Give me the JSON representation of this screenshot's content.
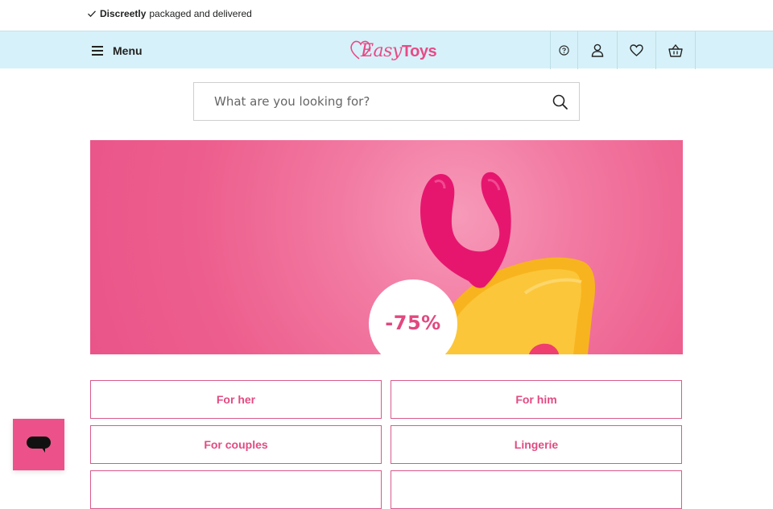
{
  "topbar": {
    "usp_bold": "Discreetly",
    "usp_rest": "packaged and delivered"
  },
  "header": {
    "menu_label": "Menu",
    "logo_easy": "Easy",
    "logo_toys": "Toys",
    "icons": [
      "help-icon",
      "account-icon",
      "wishlist-icon",
      "basket-icon"
    ]
  },
  "search": {
    "placeholder": "What are you looking for?",
    "value": ""
  },
  "banner": {
    "discount": "-75%"
  },
  "categories": [
    "For her",
    "For him",
    "For couples",
    "Lingerie"
  ],
  "colors": {
    "brand_pink": "#e94a86",
    "header_bg": "#d6f1f9",
    "chat_bg": "#ec5289"
  }
}
